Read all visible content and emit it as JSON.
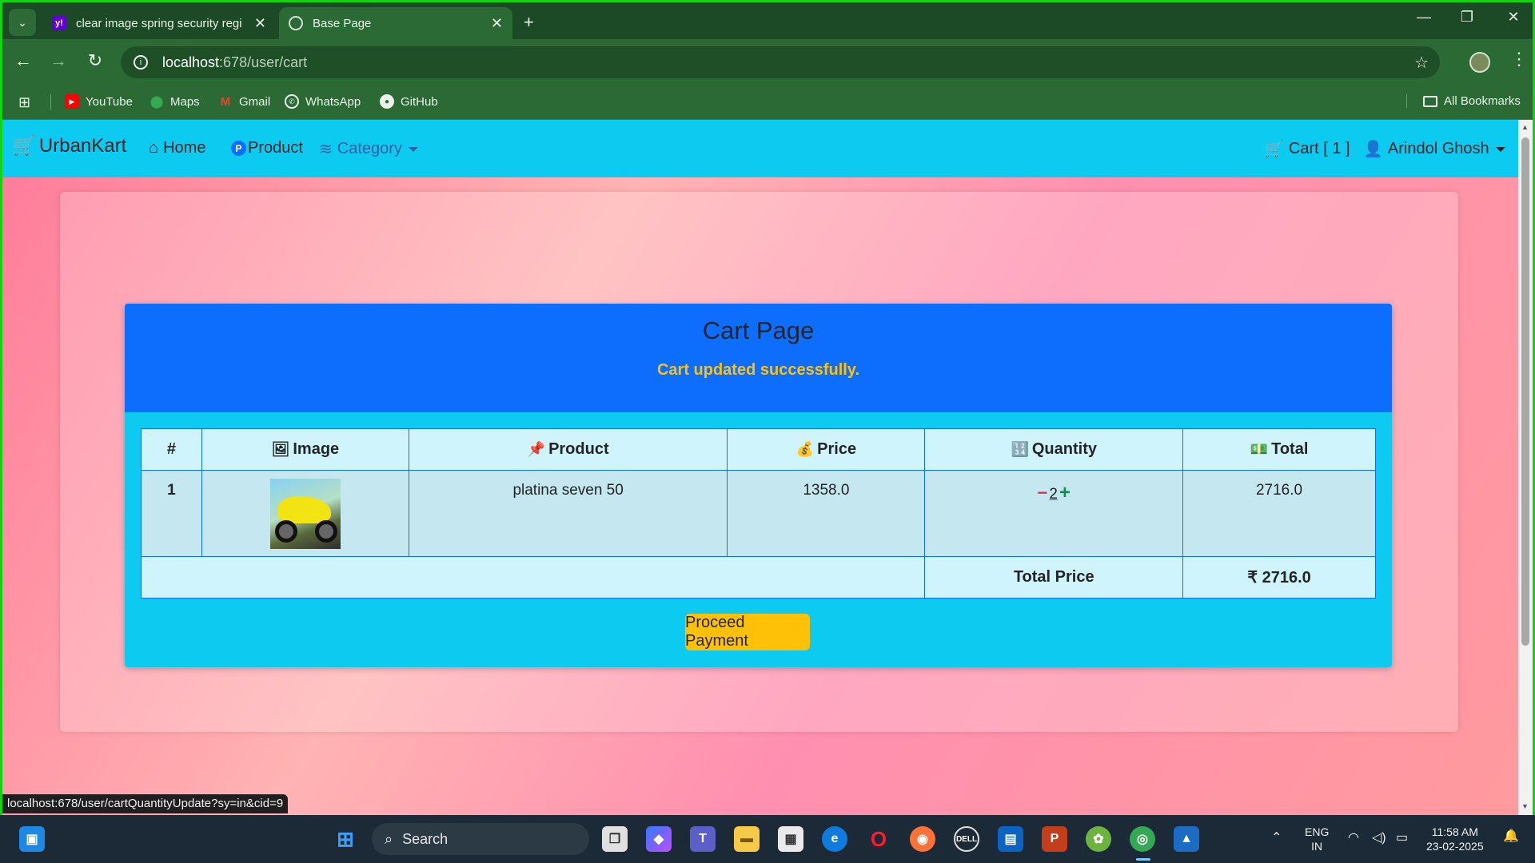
{
  "browser": {
    "tabs": [
      {
        "title": "clear image spring security regi",
        "active": false
      },
      {
        "title": "Base Page",
        "active": true
      }
    ],
    "url_host": "localhost",
    "url_path": ":678/user/cart",
    "bookmarks": [
      {
        "label": "YouTube",
        "icon": "youtube-icon"
      },
      {
        "label": "Maps",
        "icon": "maps-icon"
      },
      {
        "label": "Gmail",
        "icon": "gmail-icon"
      },
      {
        "label": "WhatsApp",
        "icon": "whatsapp-icon"
      },
      {
        "label": "GitHub",
        "icon": "github-icon"
      }
    ],
    "all_bookmarks": "All Bookmarks",
    "status_url": "localhost:678/user/cartQuantityUpdate?sy=in&cid=9"
  },
  "navbar": {
    "brand": "UrbanKart",
    "home": "Home",
    "product": "Product",
    "category": "Category",
    "cart": "Cart [ 1 ]",
    "user": "Arindol Ghosh"
  },
  "cart": {
    "title": "Cart Page",
    "message": "Cart updated successfully.",
    "headers": {
      "index": "#",
      "image": "Image",
      "product": "Product",
      "price": "Price",
      "quantity": "Quantity",
      "total": "Total"
    },
    "items": [
      {
        "index": "1",
        "product": "platina seven 50",
        "price": "1358.0",
        "quantity": "2",
        "total": "2716.0"
      }
    ],
    "total_label": "Total Price",
    "total_value": "₹ 2716.0",
    "proceed_label": "Proceed Payment"
  },
  "taskbar": {
    "search_placeholder": "Search",
    "lang_top": "ENG",
    "lang_bottom": "IN",
    "time": "11:58 AM",
    "date": "23-02-2025"
  },
  "colors": {
    "navbar": "#0dcaf0",
    "cart_header": "#0d6efd",
    "message": "#ffc107",
    "button": "#ffc107"
  }
}
